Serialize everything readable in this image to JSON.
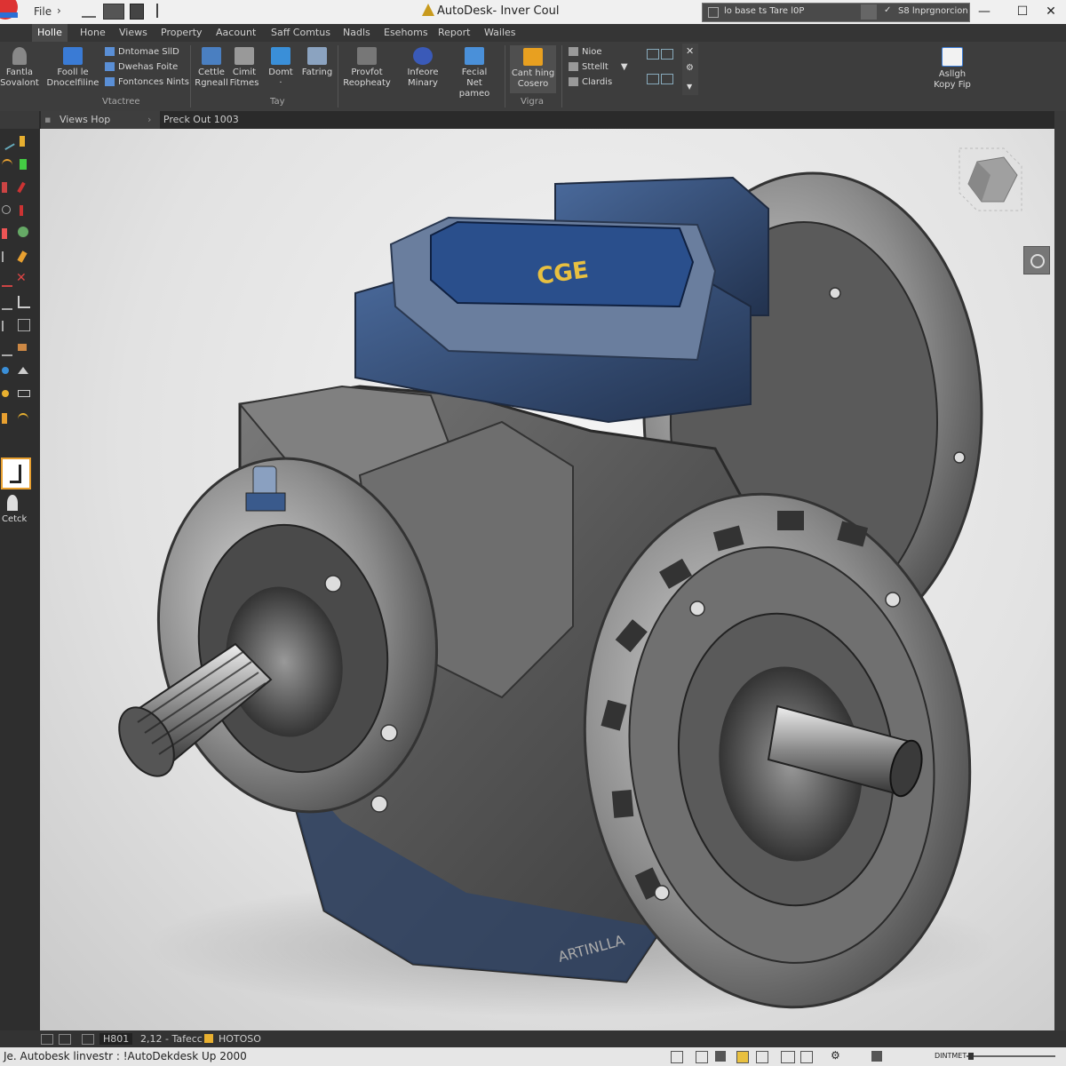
{
  "titlebar": {
    "file_menu": "File",
    "app_title": "AutoDesk- Inver Coul",
    "search_text": "lo base ts Tare l0P",
    "search_right": "S8 lnprgnorcion",
    "minimize": "—",
    "maximize": "☐",
    "close": "✕"
  },
  "ribbon_tabs": [
    "Holle",
    "Hone",
    "Views",
    "Property",
    "Aacount",
    "Saff Comtus",
    "Nadls",
    "Esehoms",
    "Report",
    "Wailes"
  ],
  "ribbon": {
    "sketch": [
      "Fantla",
      "Sovalont"
    ],
    "profile": [
      "Fooll le",
      "Dnocelfiline"
    ],
    "small_group1": [
      "Dntomae SllD",
      "Dwehas Foite",
      "Fontonces Nints"
    ],
    "group1_label": "Vtactree",
    "cettle": [
      "Cettle",
      "Rgneall"
    ],
    "cimit": [
      "Cimit",
      "Fitmes"
    ],
    "domt": [
      "Domt",
      "·"
    ],
    "fatring": [
      "Fatring",
      ""
    ],
    "group2_label": "Tay",
    "provfot": [
      "Provfot",
      "Reopheaty"
    ],
    "infoere": [
      "Infeore",
      "Minary"
    ],
    "fecial": [
      "Fecial",
      "Net pameo"
    ],
    "cant_ning": [
      "Cant hing",
      "Cosero"
    ],
    "group3_label": "Vigra",
    "small_group2": [
      "Nioe",
      "Sttellt",
      "Clardis"
    ],
    "assign": [
      "Asllgh",
      "Kopy Fip"
    ]
  },
  "doc_tabs": [
    "Views Hop",
    "Preck Out 1003"
  ],
  "left_bar": {
    "tool_label": "Cetck"
  },
  "viewport": {
    "plate_text": "CGE",
    "casting_text": "ARTINLLA"
  },
  "statusbar_top": [
    "H801",
    "2,12 - Tafecc",
    "HOTOSO"
  ],
  "statusbar": {
    "left_text": "Je. Autobesk linvestr : !AutoDekdesk Up 2000",
    "right_text": "DINTMET"
  },
  "colors": {
    "accent_blue": "#3a5a8c",
    "chrome_dark": "#3d3d3d",
    "viewport_bg": "#e6e6e6"
  }
}
